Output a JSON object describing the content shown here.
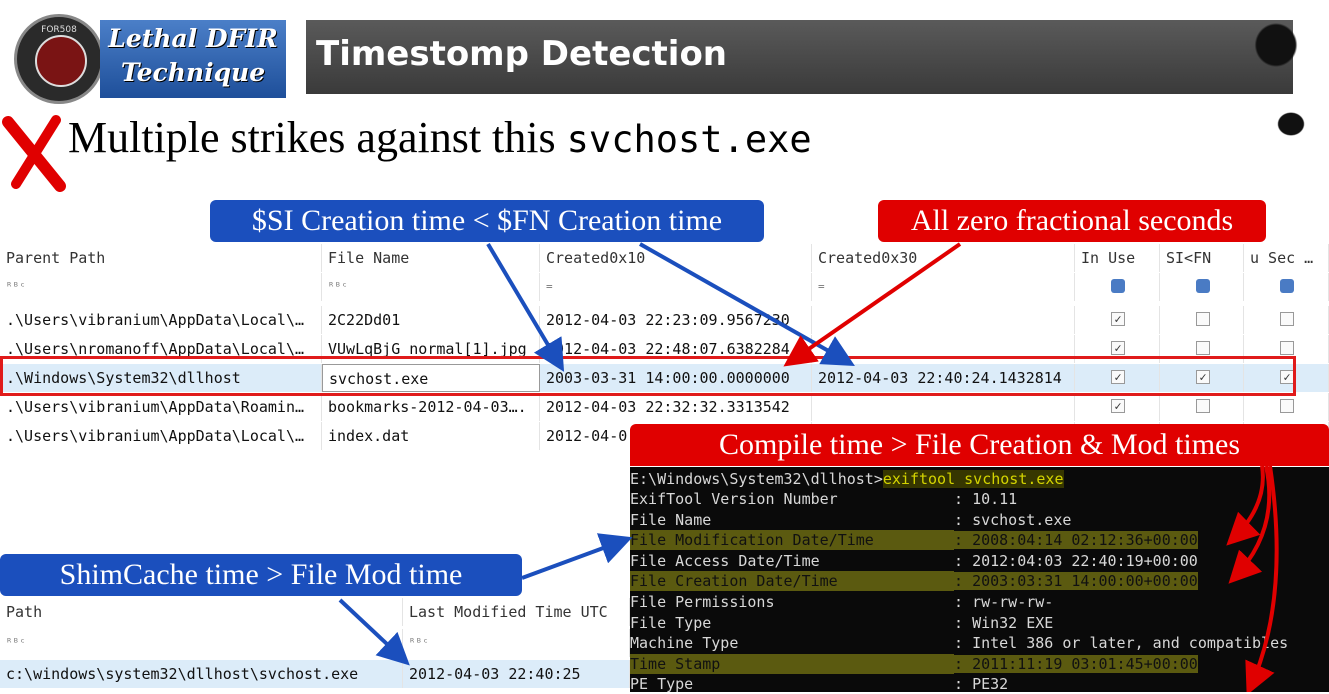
{
  "header": {
    "badge_text": "FOR508",
    "brand_line1": "Lethal DFIR",
    "brand_line2": "Technique",
    "title": "Timestomp Detection"
  },
  "headline": {
    "text": "Multiple strikes against this ",
    "filename": "svchost.exe"
  },
  "callouts": {
    "si_fn": "$SI Creation time < $FN  Creation time",
    "zero_frac": "All zero fractional seconds",
    "compile": "Compile time > File Creation & Mod times",
    "shimcache": "ShimCache time > File Mod time"
  },
  "mft_grid": {
    "columns": [
      "Parent Path",
      "File Name",
      "Created0x10",
      "Created0x30",
      "In Use",
      "SI<FN",
      "u Sec …"
    ],
    "filter_placeholder": "=",
    "rows": [
      {
        "parent": ".\\Users\\vibranium\\AppData\\Local\\…",
        "name": "2C22Dd01",
        "c10": "2012-04-03 22:23:09.9567230",
        "c30": "",
        "in_use": true,
        "si_fn": false,
        "usec": false
      },
      {
        "parent": ".\\Users\\nromanoff\\AppData\\Local\\…",
        "name": "VUwLqBjG_normal[1].jpg",
        "c10": "2012-04-03 22:48:07.6382284",
        "c30": "",
        "in_use": true,
        "si_fn": false,
        "usec": false
      },
      {
        "parent": ".\\Windows\\System32\\dllhost",
        "name": "svchost.exe",
        "c10": "2003-03-31 14:00:00.0000000",
        "c30": "2012-04-03 22:40:24.1432814",
        "in_use": true,
        "si_fn": true,
        "usec": true
      },
      {
        "parent": ".\\Users\\vibranium\\AppData\\Roamin…",
        "name": "bookmarks-2012-04-03….",
        "c10": "2012-04-03 22:32:32.3313542",
        "c30": "",
        "in_use": true,
        "si_fn": false,
        "usec": false
      },
      {
        "parent": ".\\Users\\vibranium\\AppData\\Local\\…",
        "name": "index.dat",
        "c10": "2012-04-0",
        "c30": "",
        "in_use": false,
        "si_fn": false,
        "usec": false
      }
    ]
  },
  "terminal": {
    "prompt": "E:\\Windows\\System32\\dllhost>",
    "command": "exiftool svchost.exe",
    "lines": [
      {
        "key": "ExifTool Version Number",
        "value": "10.11",
        "highlight": false
      },
      {
        "key": "File Name",
        "value": "svchost.exe",
        "highlight": false
      },
      {
        "key": "File Modification Date/Time",
        "value": "2008:04:14 02:12:36+00:00",
        "highlight": true
      },
      {
        "key": "File Access Date/Time",
        "value": "2012:04:03 22:40:19+00:00",
        "highlight": false
      },
      {
        "key": "File Creation Date/Time",
        "value": "2003:03:31 14:00:00+00:00",
        "highlight": true
      },
      {
        "key": "File Permissions",
        "value": "rw-rw-rw-",
        "highlight": false
      },
      {
        "key": "File Type",
        "value": "Win32 EXE",
        "highlight": false
      },
      {
        "key": "Machine Type",
        "value": "Intel 386 or later, and compatibles",
        "highlight": false
      },
      {
        "key": "Time Stamp",
        "value": "2011:11:19 03:01:45+00:00",
        "highlight": true
      },
      {
        "key": "PE Type",
        "value": "PE32",
        "highlight": false
      }
    ]
  },
  "shim_grid": {
    "columns": [
      "Path",
      "Last Modified Time UTC"
    ],
    "rows": [
      {
        "path": "c:\\windows\\system32\\dllhost\\svchost.exe",
        "modified": "2012-04-03 22:40:25"
      }
    ]
  }
}
